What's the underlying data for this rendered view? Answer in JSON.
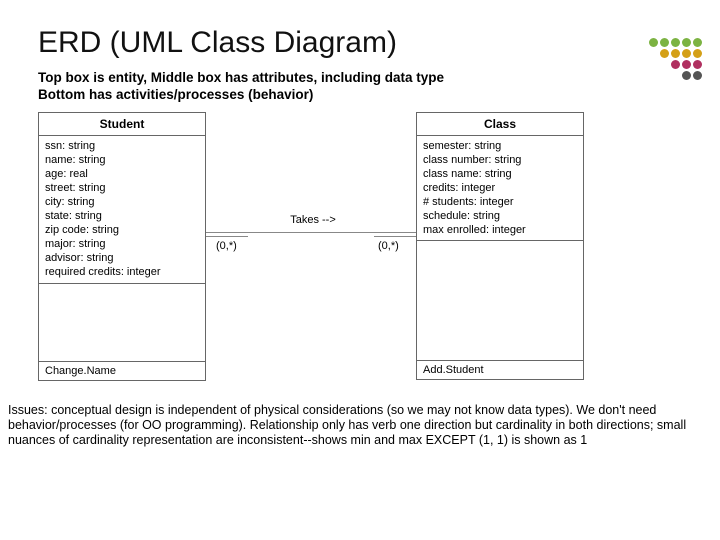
{
  "title": "ERD (UML Class Diagram)",
  "subtitle_line1": "Top box is entity, Middle box has attributes, including data type",
  "subtitle_line2": "Bottom has activities/processes (behavior)",
  "entities": {
    "student": {
      "name": "Student",
      "attrs": [
        "ssn: string",
        "name: string",
        "age: real",
        "street: string",
        "city: string",
        "state: string",
        "zip code: string",
        "major: string",
        "advisor: string",
        "required credits: integer"
      ],
      "methods": [
        "Change.Name"
      ]
    },
    "class": {
      "name": "Class",
      "attrs": [
        "semester: string",
        "class number: string",
        "class name: string",
        "credits: integer",
        "# students: integer",
        "schedule: string",
        "max enrolled: integer"
      ],
      "methods": [
        "Add.Student"
      ]
    }
  },
  "relationship": {
    "label": "Takes -->",
    "left_card": "(0,*)",
    "right_card": "(0,*)"
  },
  "issues": "Issues: conceptual design is independent of physical considerations (so we may not know data types). We don't need behavior/processes (for OO programming). Relationship only has verb one direction but cardinality in both directions; small nuances of cardinality representation are inconsistent--shows min and max EXCEPT (1, 1) is shown as 1",
  "decor_colors": {
    "r1": [
      "#7cb342",
      "#7cb342",
      "#7cb342",
      "#7cb342",
      "#7cb342"
    ],
    "r2": [
      "#d4a017",
      "#d4a017",
      "#d4a017",
      "#d4a017"
    ],
    "r3": [
      "#b03060",
      "#b03060",
      "#b03060"
    ],
    "r4": [
      "#555",
      "#555"
    ]
  }
}
